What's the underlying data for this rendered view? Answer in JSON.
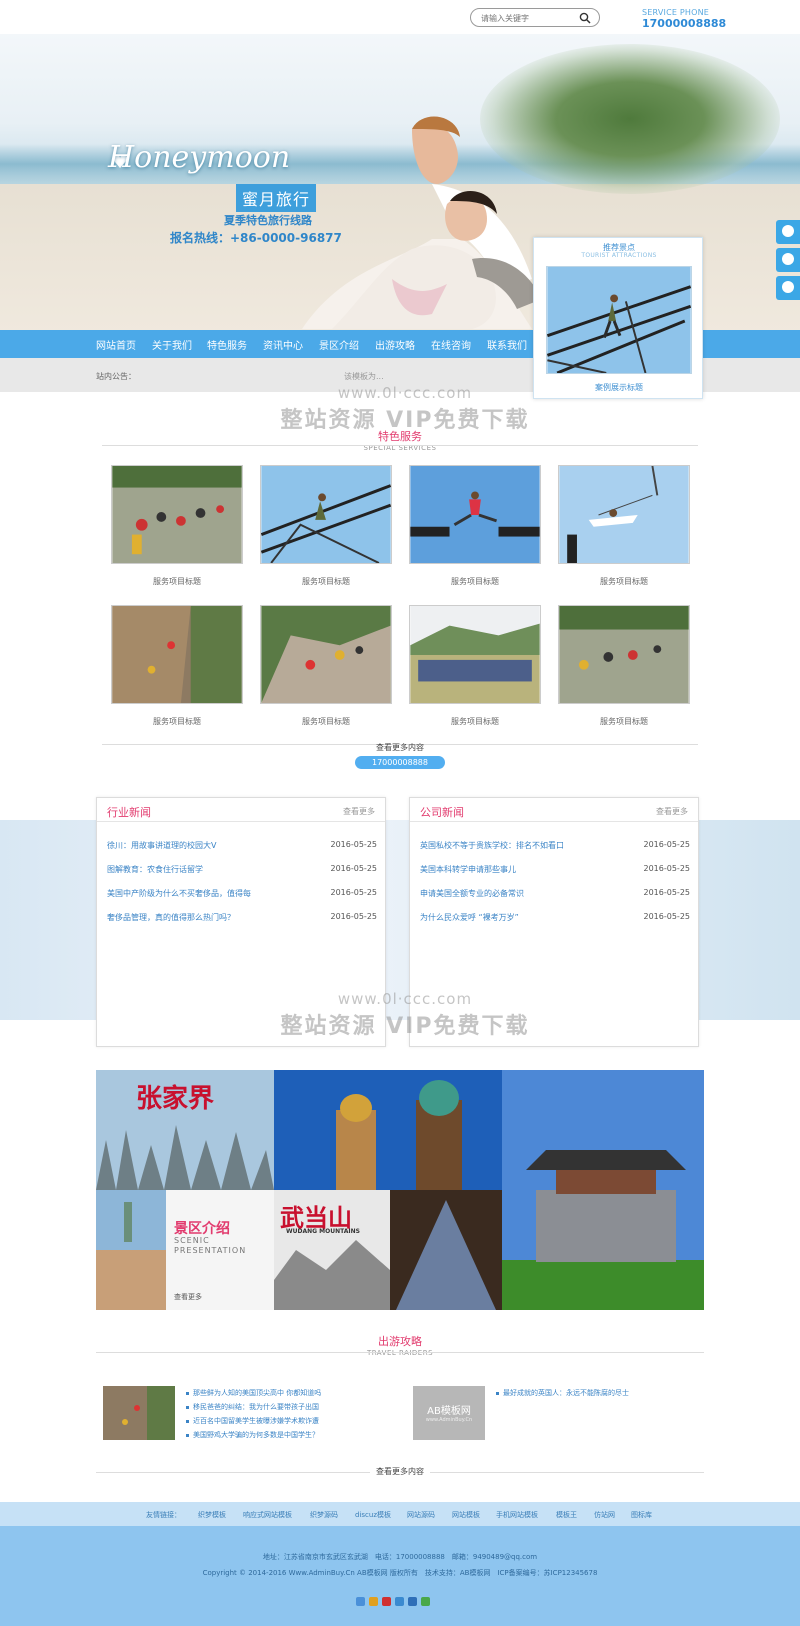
{
  "header": {
    "search_placeholder": "请输入关键字",
    "service_label": "SERVICE PHONE",
    "service_phone": "17000008888"
  },
  "banner": {
    "script_title": "Honeymoon",
    "tag": "蜜月旅行",
    "line1": "夏季特色旅行线路",
    "line2": "报名热线：+86-0000-96877"
  },
  "nav": {
    "items": [
      "网站首页",
      "关于我们",
      "特色服务",
      "资讯中心",
      "景区介绍",
      "出游攻略",
      "在线咨询",
      "联系我们"
    ]
  },
  "notice": {
    "label": "站内公告：",
    "text": "该模板为..."
  },
  "recommend": {
    "title": "推荐景点",
    "subtitle": "TOURIST ATTRACTIONS",
    "caption": "案例展示标题"
  },
  "services": {
    "title": "特色服务",
    "subtitle": "SPECIAL SERVICES",
    "items": [
      "服务项目标题",
      "服务项目标题",
      "服务项目标题",
      "服务项目标题",
      "服务项目标题",
      "服务项目标题",
      "服务项目标题",
      "服务项目标题"
    ],
    "more": "查看更多内容",
    "phone": "17000008888"
  },
  "news": {
    "industry": {
      "title": "行业新闻",
      "more": "查看更多",
      "rows": [
        {
          "t": "徐川：用故事讲道理的校园大V",
          "d": "2016-05-25"
        },
        {
          "t": "图解教育：农食住行话留学",
          "d": "2016-05-25"
        },
        {
          "t": "美国中产阶级为什么不买奢侈品，值得每",
          "d": "2016-05-25"
        },
        {
          "t": "奢侈品管理，真的值得那么热门吗？",
          "d": "2016-05-25"
        }
      ]
    },
    "company": {
      "title": "公司新闻",
      "more": "查看更多",
      "rows": [
        {
          "t": "英国私校不等于贵族学校：排名不如看口",
          "d": "2016-05-25"
        },
        {
          "t": "美国本科转学申请那些事儿",
          "d": "2016-05-25"
        },
        {
          "t": "申请美国全额专业的必备常识",
          "d": "2016-05-25"
        },
        {
          "t": "为什么民众爱呼 “裸考万岁”",
          "d": "2016-05-25"
        }
      ]
    }
  },
  "scenic": {
    "zhangjiajie": "张家界",
    "title_cn": "景区介绍",
    "title_en1": "SCENIC",
    "title_en2": "PRESENTATION",
    "more": "查看更多",
    "wudang": "武当山",
    "wudang_en": "WUDANG MOUNTAINS"
  },
  "travel": {
    "title": "出游攻略",
    "subtitle": "TRAVEL RAIDERS",
    "left_items": [
      "那些鲜为人知的美国顶尖高中 你都知道吗",
      "移民爸爸的纠结：我为什么要带孩子出国",
      "近百名中国留美学生被曝涉嫌学术欺诈遭",
      "美国野鸡大学骗的为何多数是中国学生？"
    ],
    "logo_text": "AB模板网",
    "logo_sub": "www.AdminBuy.Cn",
    "right_items": [
      "最好成就的英国人：永远不能陈腐的尽士"
    ],
    "more": "查看更多内容"
  },
  "footer": {
    "links_label": "友情链接：",
    "links": [
      "织梦模板",
      "响应式网站模板",
      "织梦源码",
      "discuz模板",
      "网站源码",
      "网站模板",
      "手机网站模板",
      "模板王",
      "仿站网",
      "图标库"
    ],
    "address": "地址：江苏省南京市玄武区玄武湖　电话：17000008888　邮箱：9490489@qq.com",
    "copyright": "Copyright © 2014-2016 Www.AdminBuy.Cn AB模板网 版权所有　技术支持：AB模板网　ICP备案编号：苏ICP12345678"
  },
  "watermark": {
    "en1": "www.0l·ccc.com",
    "cn": "整站资源 VIP免费下载",
    "en2": "www.0l·ccc.com"
  },
  "colors": {
    "accent": "#4ba9e8",
    "heading": "#e23b6e",
    "link": "#3b84c6"
  }
}
